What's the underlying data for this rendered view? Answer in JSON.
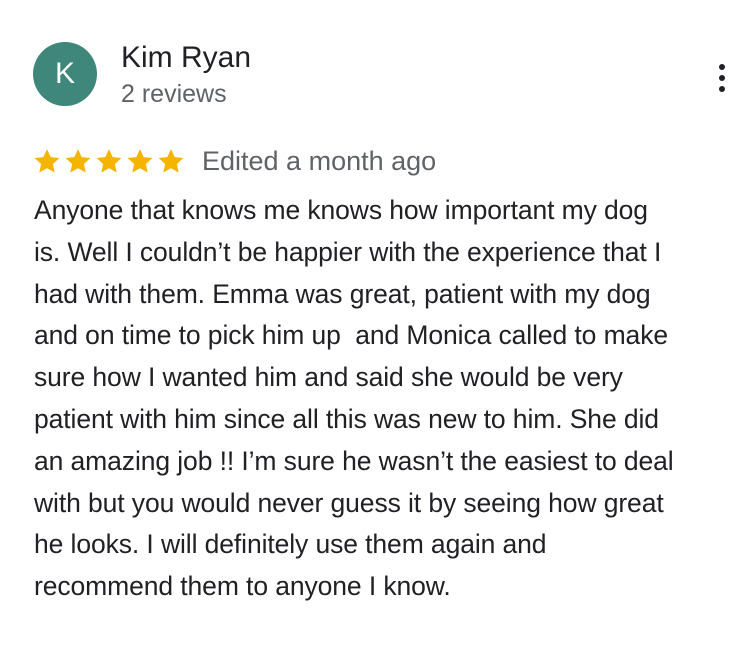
{
  "reviewer": {
    "initial": "K",
    "name": "Kim Ryan",
    "review_count": "2 reviews"
  },
  "rating": {
    "stars": 5,
    "max_stars": 5,
    "edited_label": "Edited a month ago"
  },
  "review": {
    "lines": [
      "Anyone that knows me knows how important my dog",
      "is. Well I couldn’t be happier with the experience that I",
      "had with them. Emma was great, patient with my dog",
      "and on time to pick him up  and Monica called to make",
      "sure how I wanted him and said she would be very",
      "patient with him since all this was new to him. She did",
      "an amazing job !! I’m sure he wasn’t the easiest to deal",
      "with but you would never guess it by seeing how great",
      "he looks. I will definitely use them again and",
      "recommend them to anyone I know."
    ]
  },
  "icons": {
    "more": "more-vert-icon",
    "star": "star-icon"
  },
  "colors": {
    "avatar_bg": "#3f877b",
    "star": "#f4b400",
    "primary_text": "#202124",
    "secondary_text": "#5f6368"
  }
}
